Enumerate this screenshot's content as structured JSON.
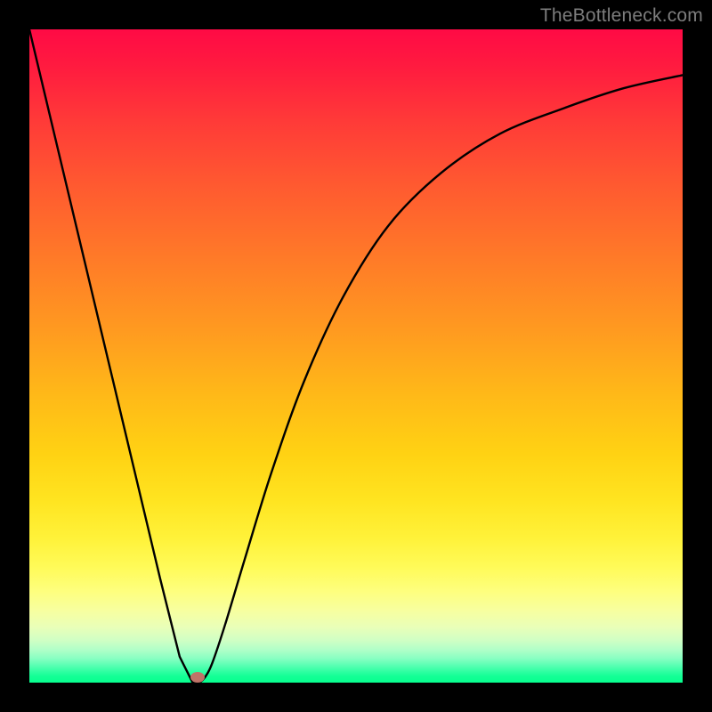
{
  "watermark": "TheBottleneck.com",
  "dot": {
    "x_frac": 0.258,
    "y_frac": 0.992,
    "color": "#c07368"
  },
  "chart_data": {
    "type": "line",
    "title": "",
    "xlabel": "",
    "ylabel": "",
    "xlim": [
      0,
      100
    ],
    "ylim": [
      0,
      100
    ],
    "grid": false,
    "legend": false,
    "notes": "Bottleneck-style V curve over rainbow gradient; axes unlabeled. x represents hardware score fraction (0–100), y represents bottleneck percentage (0=green bottom, 100=red top). Minimum at approx x=25 where bottleneck ~0%. Values estimated from pixel positions.",
    "series": [
      {
        "name": "bottleneck-curve",
        "x": [
          0,
          5,
          10,
          15,
          20,
          23,
          25,
          26,
          27,
          28,
          30,
          33,
          37,
          42,
          48,
          55,
          63,
          72,
          82,
          91,
          100
        ],
        "values": [
          100,
          79,
          58,
          37,
          16,
          4,
          0,
          0,
          1,
          3,
          9,
          19,
          32,
          46,
          59,
          70,
          78,
          84,
          88,
          91,
          93
        ]
      }
    ]
  }
}
